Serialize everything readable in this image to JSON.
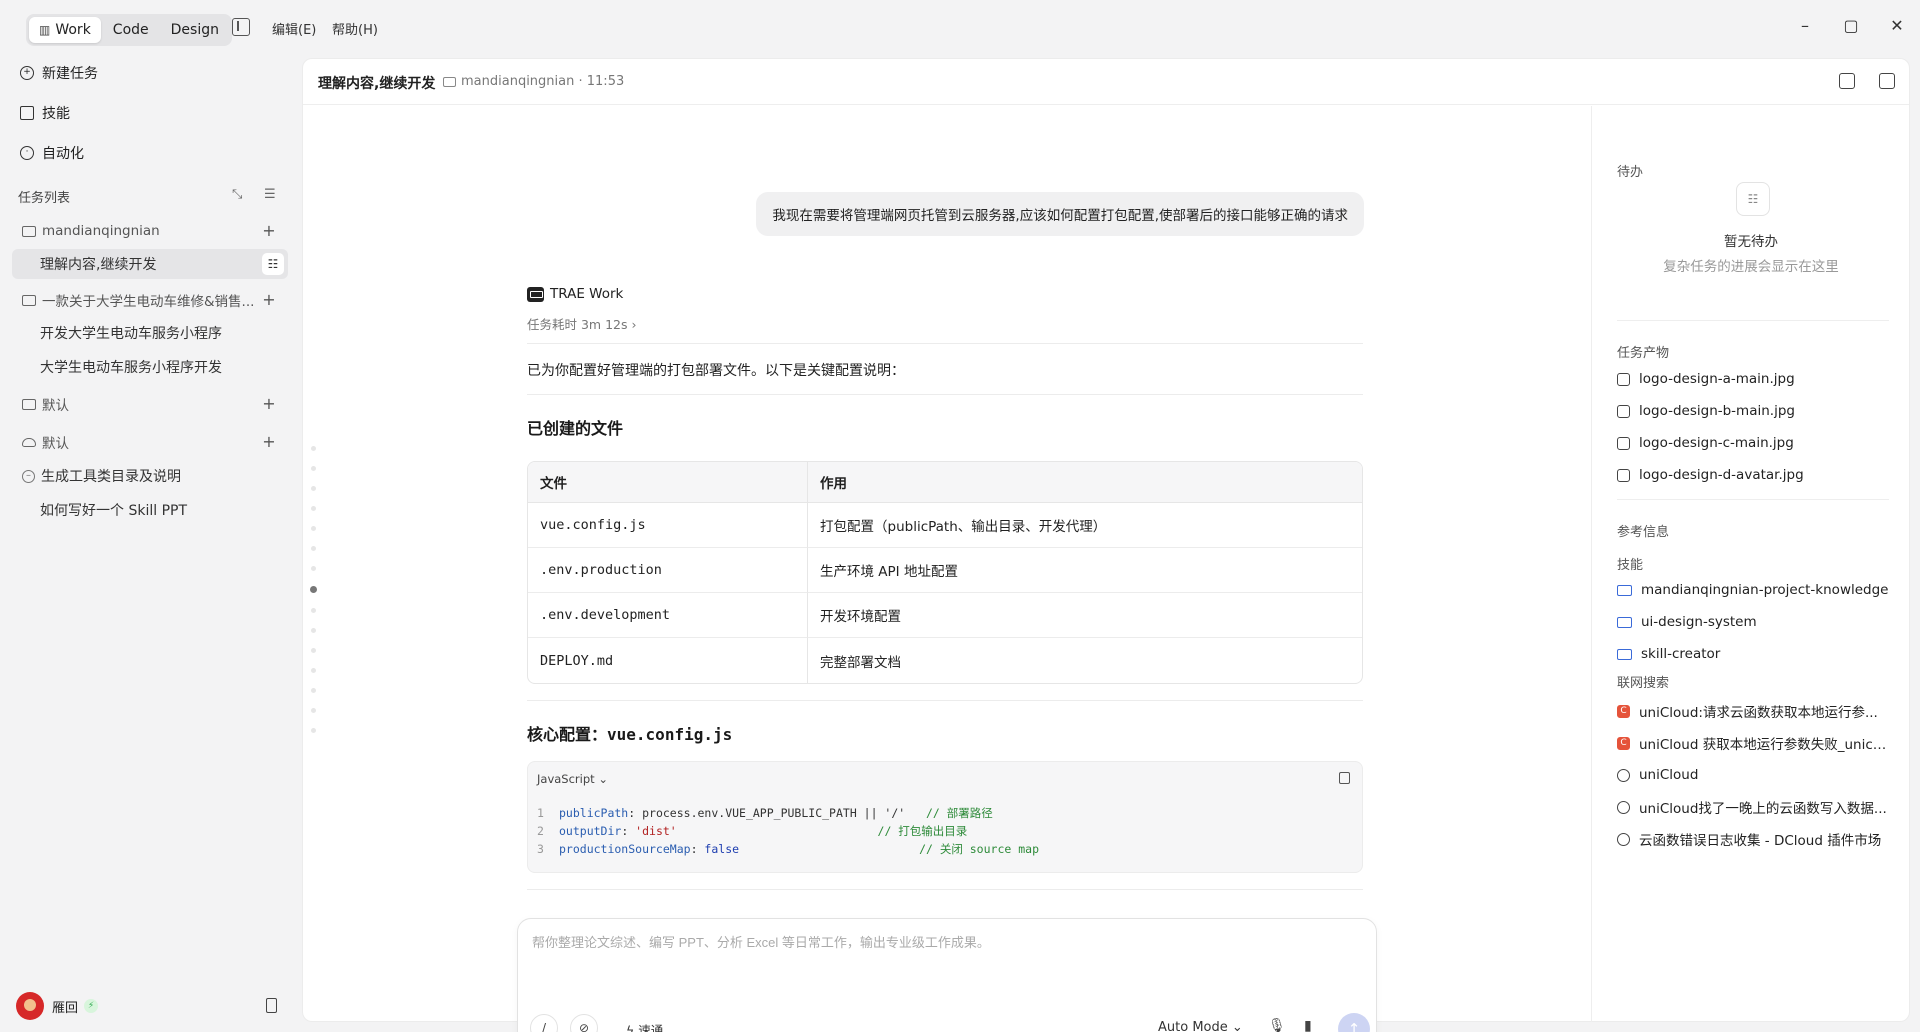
{
  "topbar": {
    "modes": [
      {
        "label": "Work",
        "active": true,
        "icon": "book-icon"
      },
      {
        "label": "Code",
        "active": false
      },
      {
        "label": "Design",
        "active": false
      }
    ],
    "menus": [
      "编辑(E)",
      "帮助(H)"
    ]
  },
  "sidebar": {
    "nav": [
      {
        "label": "新建任务",
        "icon": "plus-circle-icon"
      },
      {
        "label": "技能",
        "icon": "book-icon"
      },
      {
        "label": "自动化",
        "icon": "clock-icon"
      }
    ],
    "task_list_title": "任务列表",
    "groups": [
      {
        "label": "mandianqingnian",
        "icon": "folder-icon",
        "children": [
          {
            "label": "理解内容,继续开发",
            "selected": true
          }
        ]
      },
      {
        "label": "一款关于大学生电动车维修&销售...",
        "icon": "folder-icon",
        "children": [
          {
            "label": "开发大学生电动车服务小程序"
          },
          {
            "label": "大学生电动车服务小程序开发"
          }
        ]
      },
      {
        "label": "默认",
        "icon": "folder-icon",
        "children": []
      },
      {
        "label": "默认",
        "icon": "cloud-icon",
        "children": []
      }
    ],
    "loose_tasks": [
      "生成工具类目录及说明",
      "如何写好一个 Skill PPT"
    ],
    "user": {
      "name": "雁回"
    }
  },
  "header": {
    "task_title": "理解内容,继续开发",
    "folder": "mandianqingnian",
    "time": "11:53"
  },
  "chat": {
    "user_message": "我现在需要将管理端网页托管到云服务器,应该如何配置打包配置,使部署后的接口能够正确的请求",
    "agent_name": "TRAE Work",
    "elapsed": "任务耗时 3m 12s",
    "intro": "已为你配置好管理端的打包部署文件。以下是关键配置说明：",
    "files_heading": "已创建的文件",
    "files_table": {
      "headers": [
        "文件",
        "作用"
      ],
      "rows": [
        [
          "vue.config.js",
          "打包配置（publicPath、输出目录、开发代理）"
        ],
        [
          ".env.production",
          "生产环境 API 地址配置"
        ],
        [
          ".env.development",
          "开发环境配置"
        ],
        [
          "DEPLOY.md",
          "完整部署文档"
        ]
      ]
    },
    "core_heading": "核心配置：",
    "core_file": "vue.config.js",
    "code_lang": "JavaScript",
    "code_lines": [
      {
        "n": "1",
        "key": "publicPath",
        "value": "process.env.VUE_APP_PUBLIC_PATH || '/'",
        "comment": "// 部署路径"
      },
      {
        "n": "2",
        "key": "outputDir",
        "value": "'dist'",
        "comment": "// 打包输出目录"
      },
      {
        "n": "3",
        "key": "productionSourceMap",
        "value": "false",
        "comment": "// 关闭 source map"
      }
    ]
  },
  "composer": {
    "placeholder": "帮你整理论文综述、编写 PPT、分析 Excel 等日常工作，输出专业级工作成果。",
    "speed_label": "速通",
    "mode_label": "Auto Mode"
  },
  "right_panel": {
    "todo_title": "待办",
    "todo_empty_title": "暂无待办",
    "todo_empty_sub": "复杂任务的进展会显示在这里",
    "artifacts_title": "任务产物",
    "artifacts": [
      "logo-design-a-main.jpg",
      "logo-design-b-main.jpg",
      "logo-design-c-main.jpg",
      "logo-design-d-avatar.jpg"
    ],
    "ref_title": "参考信息",
    "skills_title": "技能",
    "skills": [
      "mandianqingnian-project-knowledge",
      "ui-design-system",
      "skill-creator"
    ],
    "web_title": "联网搜索",
    "web_results": [
      {
        "label": "uniCloud:请求云函数获取本地运行参...",
        "icon": "red-c-icon"
      },
      {
        "label": "uniCloud 获取本地运行参数失败_unicl...",
        "icon": "red-c-icon"
      },
      {
        "label": "uniCloud",
        "icon": "globe-icon"
      },
      {
        "label": "uniCloud找了一晚上的云函数写入数据...",
        "icon": "globe-icon"
      },
      {
        "label": "云函数错误日志收集 - DCloud 插件市场",
        "icon": "globe-icon"
      }
    ]
  },
  "colors": {
    "accent": "#3a6ad8",
    "send_disabled": "#cdd4f3",
    "sidebar_bg": "#f3f3f4"
  }
}
